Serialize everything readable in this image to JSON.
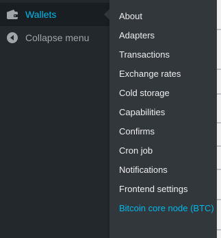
{
  "sidebar": {
    "current_item": {
      "label": "Wallets",
      "icon": "wallet-icon"
    },
    "collapse_item": {
      "label": "Collapse menu",
      "icon": "collapse-arrow-icon"
    }
  },
  "submenu": {
    "items": [
      {
        "label": "About"
      },
      {
        "label": "Adapters"
      },
      {
        "label": "Transactions"
      },
      {
        "label": "Exchange rates"
      },
      {
        "label": "Cold storage"
      },
      {
        "label": "Capabilities"
      },
      {
        "label": "Confirms"
      },
      {
        "label": "Cron job"
      },
      {
        "label": "Notifications"
      },
      {
        "label": "Frontend settings"
      },
      {
        "label": "Bitcoin core node (BTC)"
      }
    ]
  },
  "colors": {
    "sidebar_bg": "#23282d",
    "current_bg": "#191e23",
    "submenu_bg": "#32373c",
    "accent": "#00b9eb",
    "text": "#eeeeee",
    "muted_text": "#a0a5aa"
  }
}
